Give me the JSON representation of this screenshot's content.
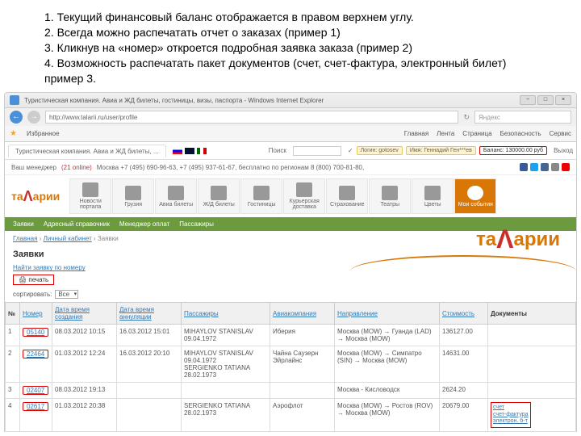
{
  "instructions": [
    "1. Текущий финансовый баланс отображается в правом верхнем углу.",
    "2. Всегда можно распечатать отчет о заказах (пример 1)",
    "3. Кликнув на «номер» откроется подробная заявка заказа (пример 2)",
    "4. Возможность распечатать пакет документов (счет, счет-фактура, электронный билет) пример 3."
  ],
  "browser": {
    "title": "Туристическая компания. Авиа и ЖД билеты, гостиницы, визы, паспорта - Windows Internet Explorer",
    "url": "http://www.talarii.ru/user/profile",
    "search_placeholder": "Яндекс",
    "fav_label": "Избранное",
    "fav_items": [
      "Главная",
      "Лента",
      "Страница",
      "Безопасность",
      "Сервис"
    ],
    "min": "−",
    "max": "□",
    "close": "×"
  },
  "page_tab": "Туристическая компания. Авиа и ЖД билеты, ...",
  "login_area": {
    "label": "Поиск",
    "login": "Логин: gotosev",
    "name": "Имя: Геннадий Ген***ев",
    "balance": "Баланс: 130000.00 руб",
    "exit": "Выход"
  },
  "contact_row": {
    "left": "Ваш менеджер",
    "count": "(21 online)",
    "phones": "Москва +7 (495) 690-96-63, +7 (495) 937-61-67, бесплатно по регионам 8 (800) 700-81-80,",
    "social": "✉"
  },
  "brand": "та^арии",
  "nav": [
    {
      "label": "Новости портала"
    },
    {
      "label": "Грузия"
    },
    {
      "label": "Авиа билеты"
    },
    {
      "label": "Ж/Д билеты"
    },
    {
      "label": "Гостиницы"
    },
    {
      "label": "Курьерская доставка"
    },
    {
      "label": "Страхование"
    },
    {
      "label": "Театры"
    },
    {
      "label": "Цветы"
    },
    {
      "label": "Мои события"
    }
  ],
  "green_nav": [
    "Заявки",
    "Адресный справочник",
    "Менеджер оплат",
    "Пассажиры"
  ],
  "breadcrumb": {
    "a": "Главная",
    "b": "Личный кабинет",
    "c": "Заявки"
  },
  "section_title": "Заявки",
  "filter_link": "Найти заявку по номеру",
  "print_btn": "🖨 печать",
  "sort": {
    "label": "сортировать:",
    "value": "Все"
  },
  "table": {
    "headers": {
      "num": "№",
      "order": "Номер",
      "created": "Дата время создания",
      "cancelled": "Дата время аннуляции",
      "pass": "Пассажиры",
      "air": "Авиакомпания",
      "dir": "Направление",
      "cost": "Стоимость",
      "docs": "Документы"
    },
    "rows": [
      {
        "n": "1",
        "order": "05140",
        "created": "08.03.2012 10:15",
        "cancelled": "16.03.2012 15:01",
        "pass": "MIHAYLOV STANISLAV 09.04.1972",
        "air": "Иберия",
        "dir": "Москва (MOW) → Гуанда (LAD) → Москва (MOW)",
        "cost": "136127.00",
        "docs": ""
      },
      {
        "n": "2",
        "order": "22464",
        "created": "01.03.2012 12:24",
        "cancelled": "16.03.2012 20:10",
        "pass": "MIHAYLOV STANISLAV 09.04.1972\nSERGIENKO TATIANA 28.02.1973",
        "air": "Чайна Саузерн Эйрлайнс",
        "dir": "Москва (MOW) → Симпатро (SIN) → Москва (MOW)",
        "cost": "14631.00",
        "docs": ""
      },
      {
        "n": "3",
        "order": "02407",
        "created": "08.03.2012 19:13",
        "cancelled": "",
        "pass": "",
        "air": "",
        "dir": "Москва - Кисловодск",
        "cost": "2624.20",
        "docs": ""
      },
      {
        "n": "4",
        "order": "02617",
        "created": "01.03.2012 20:38",
        "cancelled": "",
        "pass": "SERGIENKO TATIANA 28.02.1973",
        "air": "Аэрофлот",
        "dir": "Москва (MOW) → Ростов (ROV) → Москва (MOW)",
        "cost": "20679.00",
        "docs": "счет\nсчет-фактура\nэлектрон. б-т"
      }
    ]
  }
}
